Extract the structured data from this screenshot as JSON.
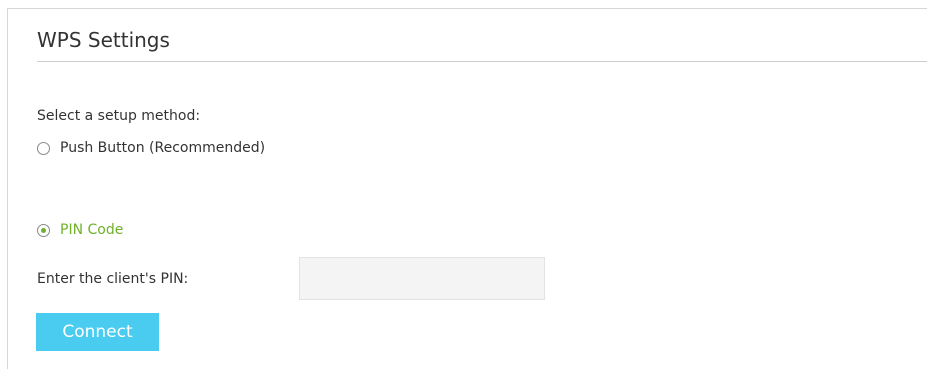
{
  "section": {
    "title": "WPS Settings"
  },
  "setup": {
    "prompt": "Select a setup method:",
    "options": [
      {
        "label": "Push Button (Recommended)",
        "selected": false
      },
      {
        "label": "PIN Code",
        "selected": true
      }
    ]
  },
  "pin": {
    "label": "Enter the client's PIN:",
    "value": "",
    "placeholder": ""
  },
  "actions": {
    "connect_label": "Connect"
  },
  "colors": {
    "accent_green": "#6fb12a",
    "button_blue": "#4acbf0",
    "input_background": "#f4f4f4"
  }
}
